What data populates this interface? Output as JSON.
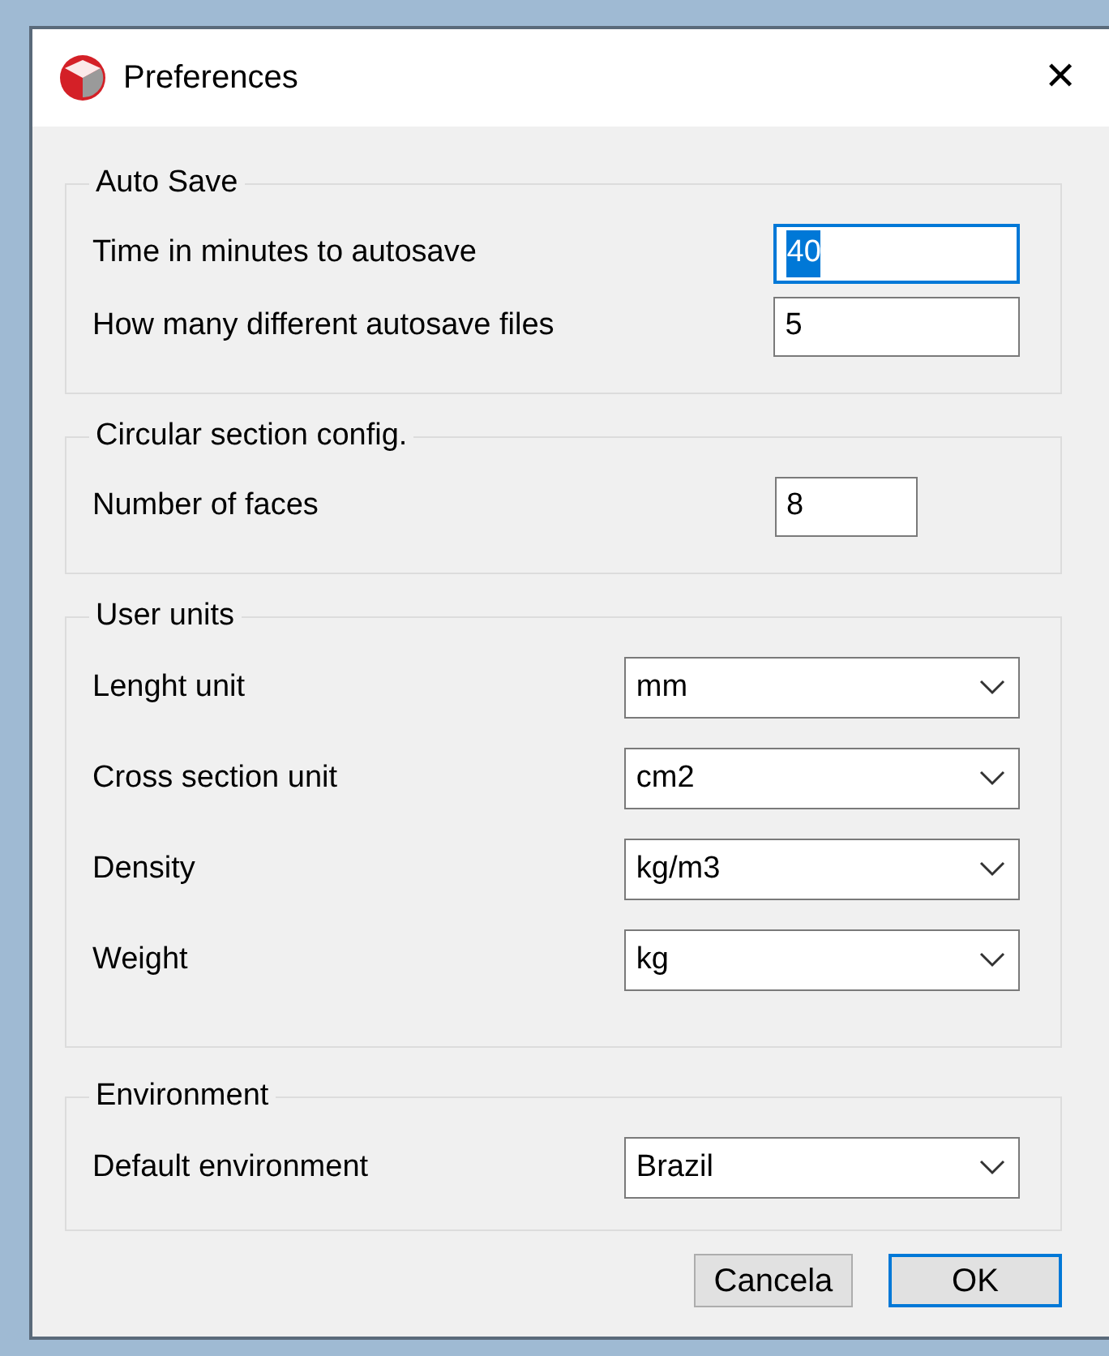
{
  "window": {
    "title": "Preferences",
    "close": "✕"
  },
  "groups": [
    {
      "title": "Auto Save",
      "fields": [
        {
          "kind": "text",
          "label": "Time in minutes to autosave",
          "value": "40",
          "focused": true
        },
        {
          "kind": "text",
          "label": "How many different autosave files",
          "value": "5",
          "focused": false
        }
      ]
    },
    {
      "title": "Circular section config.",
      "fields": [
        {
          "kind": "text",
          "label": "Number of faces",
          "value": "8",
          "focused": false
        }
      ]
    },
    {
      "title": "User units",
      "fields": [
        {
          "kind": "select",
          "label": "Lenght unit",
          "value": "mm"
        },
        {
          "kind": "select",
          "label": "Cross section unit",
          "value": "cm2"
        },
        {
          "kind": "select",
          "label": "Density",
          "value": "kg/m3"
        },
        {
          "kind": "select",
          "label": "Weight",
          "value": "kg"
        }
      ]
    },
    {
      "title": "Environment",
      "fields": [
        {
          "kind": "select",
          "label": "Default environment",
          "value": "Brazil"
        }
      ]
    }
  ],
  "buttons": [
    {
      "label": "Cancela",
      "default": false
    },
    {
      "label": "OK",
      "default": true
    }
  ]
}
